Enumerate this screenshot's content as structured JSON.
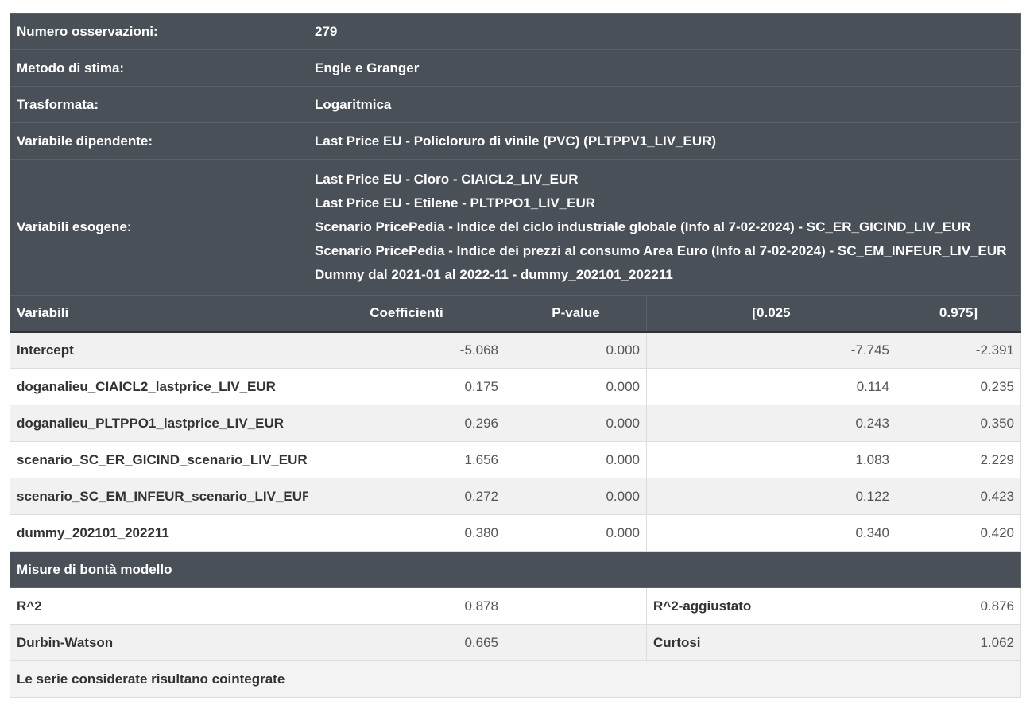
{
  "info": {
    "n_obs_label": "Numero osservazioni:",
    "n_obs_value": "279",
    "method_label": "Metodo di stima:",
    "method_value": "Engle e Granger",
    "transform_label": "Trasformata:",
    "transform_value": "Logaritmica",
    "dep_label": "Variabile dipendente:",
    "dep_value": "Last Price EU - Policloruro di vinile (PVC) (PLTPPV1_LIV_EUR)",
    "exo_label": "Variabili esogene:",
    "exo_values": [
      "Last Price EU - Cloro - CIAICL2_LIV_EUR",
      "Last Price EU - Etilene - PLTPPO1_LIV_EUR",
      "Scenario PricePedia - Indice del ciclo industriale globale (Info al 7-02-2024) - SC_ER_GICIND_LIV_EUR",
      "Scenario PricePedia - Indice dei prezzi al consumo Area Euro (Info al 7-02-2024) - SC_EM_INFEUR_LIV_EUR",
      "Dummy dal 2021-01 al 2022-11 - dummy_202101_202211"
    ]
  },
  "coef_table": {
    "headers": [
      "Variabili",
      "Coefficienti",
      "P-value",
      "[0.025",
      "0.975]"
    ],
    "rows": [
      {
        "name": "Intercept",
        "coef": "-5.068",
        "pvalue": "0.000",
        "lo": "-7.745",
        "hi": "-2.391"
      },
      {
        "name": "doganalieu_CIAICL2_lastprice_LIV_EUR",
        "coef": "0.175",
        "pvalue": "0.000",
        "lo": "0.114",
        "hi": "0.235"
      },
      {
        "name": "doganalieu_PLTPPO1_lastprice_LIV_EUR",
        "coef": "0.296",
        "pvalue": "0.000",
        "lo": "0.243",
        "hi": "0.350"
      },
      {
        "name": "scenario_SC_ER_GICIND_scenario_LIV_EUR",
        "coef": "1.656",
        "pvalue": "0.000",
        "lo": "1.083",
        "hi": "2.229"
      },
      {
        "name": "scenario_SC_EM_INFEUR_scenario_LIV_EUR",
        "coef": "0.272",
        "pvalue": "0.000",
        "lo": "0.122",
        "hi": "0.423"
      },
      {
        "name": "dummy_202101_202211",
        "coef": "0.380",
        "pvalue": "0.000",
        "lo": "0.340",
        "hi": "0.420"
      }
    ]
  },
  "fit": {
    "section_label": "Misure di bontà modello",
    "r2_label": "R^2",
    "r2_value": "0.878",
    "r2adj_label": "R^2-aggiustato",
    "r2adj_value": "0.876",
    "dw_label": "Durbin-Watson",
    "dw_value": "0.665",
    "kurt_label": "Curtosi",
    "kurt_value": "1.062"
  },
  "conclusion": "Le serie considerate risultano cointegrate",
  "colors": {
    "header_bg": "#4a5058",
    "row_alt": "#f1f1f1",
    "row_base": "#ffffff"
  }
}
